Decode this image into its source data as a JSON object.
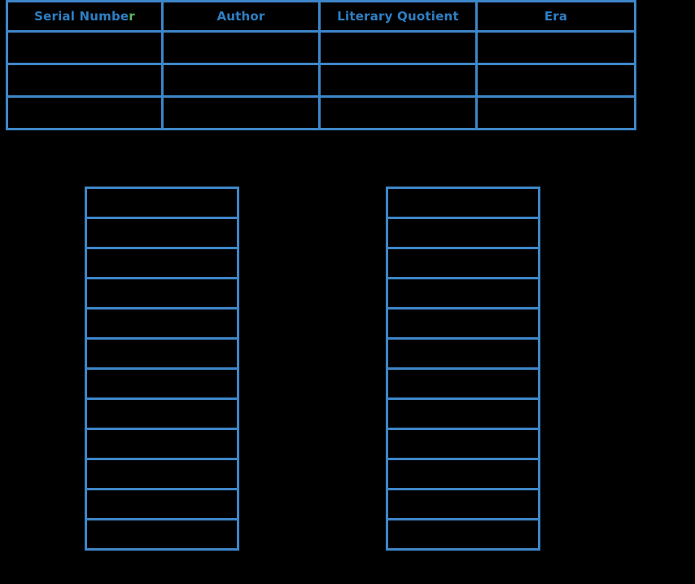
{
  "canvas": {
    "background_color": "#000000",
    "border_color": "#3e86c8",
    "header_text_color": "#2e7fc4",
    "accent_text_color": "#5cb85c"
  },
  "top_table": {
    "columns": [
      {
        "label_main": "Serial Numbe",
        "label_accent": "r",
        "full_label": "Serial Number"
      },
      {
        "label_main": "Author",
        "label_accent": "",
        "full_label": "Author"
      },
      {
        "label_main": "Literary Quotient",
        "label_accent": "",
        "full_label": "Literary Quotient"
      },
      {
        "label_main": "Era",
        "label_accent": "",
        "full_label": "Era"
      }
    ],
    "rows": [
      {
        "cells": [
          "",
          "",
          "",
          ""
        ]
      },
      {
        "cells": [
          "",
          "",
          "",
          ""
        ]
      },
      {
        "cells": [
          "",
          "",
          "",
          ""
        ]
      }
    ]
  },
  "left_stack": {
    "rows": [
      "",
      "",
      "",
      "",
      "",
      "",
      "",
      "",
      "",
      "",
      "",
      ""
    ]
  },
  "right_stack": {
    "rows": [
      "",
      "",
      "",
      "",
      "",
      "",
      "",
      "",
      "",
      "",
      "",
      ""
    ]
  }
}
